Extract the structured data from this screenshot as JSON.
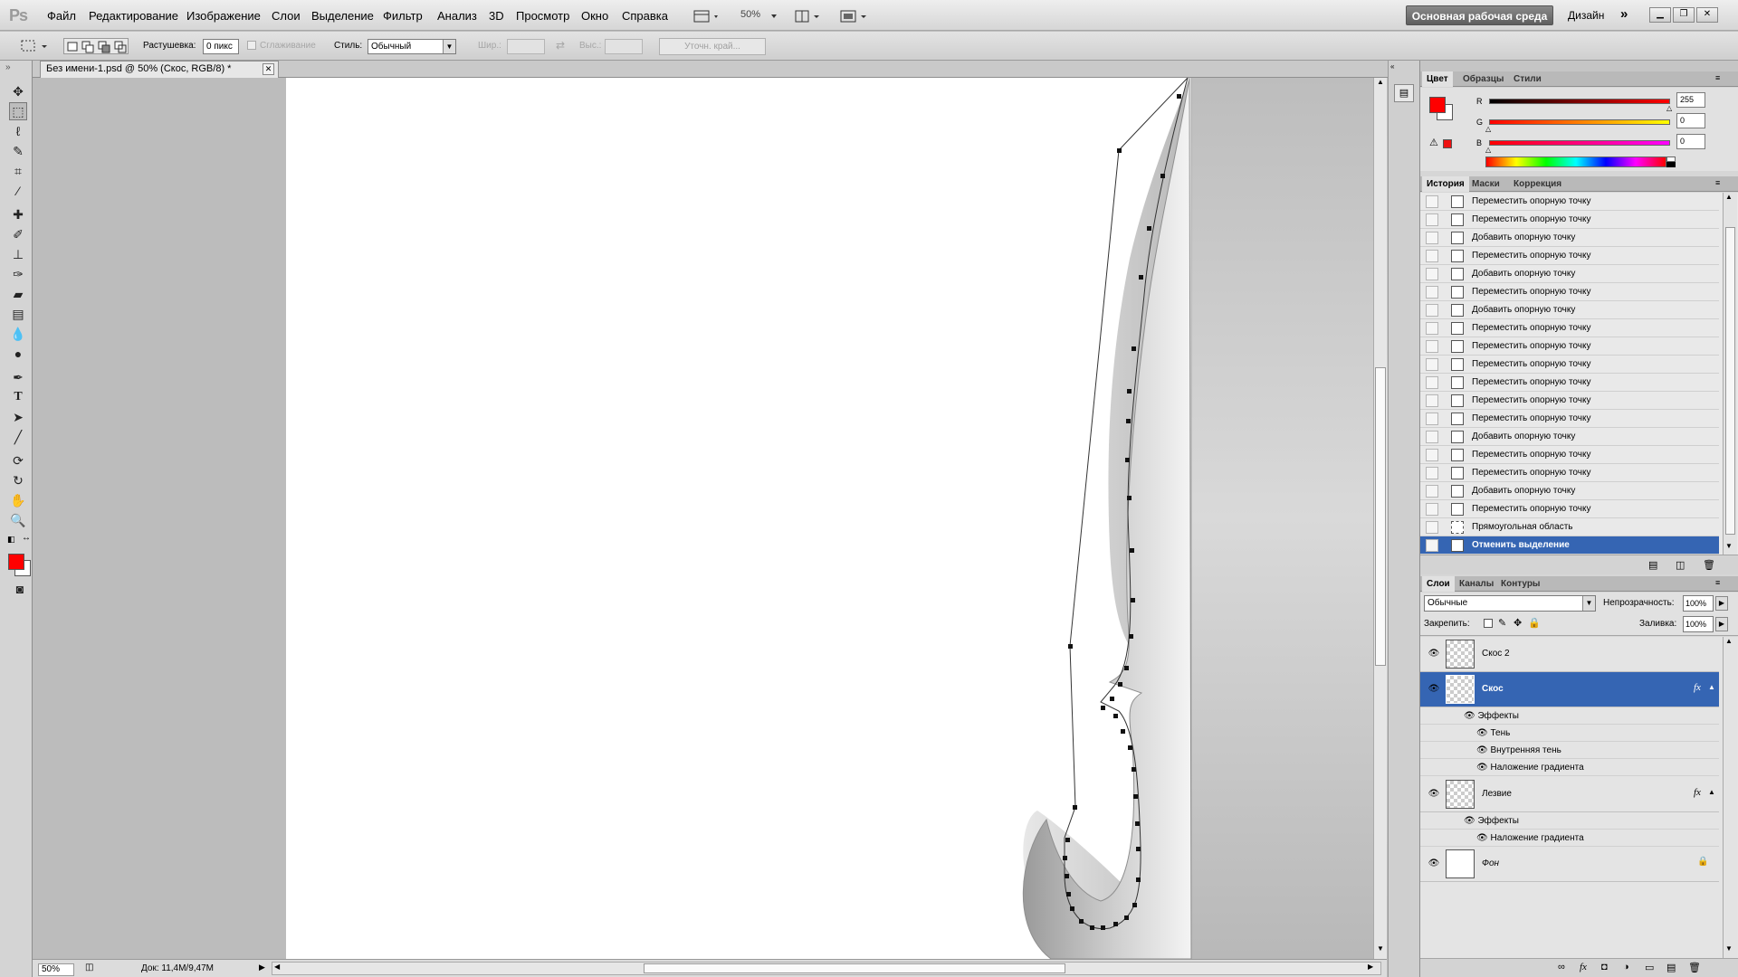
{
  "app": {
    "logo": "Ps"
  },
  "menu": [
    "Файл",
    "Редактирование",
    "Изображение",
    "Слои",
    "Выделение",
    "Фильтр",
    "Анализ",
    "3D",
    "Просмотр",
    "Окно",
    "Справка"
  ],
  "appbar": {
    "zoom": "50%",
    "workspace": "Основная рабочая среда",
    "design": "Дизайн"
  },
  "options": {
    "feather_label": "Растушевка:",
    "feather_value": "0 пикс",
    "antialias_label": "Сглаживание",
    "style_label": "Стиль:",
    "style_value": "Обычный",
    "width_label": "Шир.:",
    "height_label": "Выс.:",
    "refine_label": "Уточн. край..."
  },
  "document": {
    "tab_title": "Без имени-1.psd @ 50% (Скос, RGB/8) *"
  },
  "status": {
    "zoom": "50%",
    "doc_info": "Док: 11,4M/9,47M"
  },
  "colors": {
    "foreground": "#ff0000",
    "background": "#ffffff"
  },
  "color_panel": {
    "tabs": [
      "Цвет",
      "Образцы",
      "Стили"
    ],
    "channels": [
      {
        "label": "R",
        "value": "255"
      },
      {
        "label": "G",
        "value": "0"
      },
      {
        "label": "B",
        "value": "0"
      }
    ]
  },
  "history_panel": {
    "tabs": [
      "История",
      "Маски",
      "Коррекция"
    ],
    "items": [
      "Переместить опорную точку",
      "Переместить опорную точку",
      "Добавить опорную точку",
      "Переместить опорную точку",
      "Добавить опорную точку",
      "Переместить опорную точку",
      "Добавить опорную точку",
      "Переместить опорную точку",
      "Переместить опорную точку",
      "Переместить опорную точку",
      "Переместить опорную точку",
      "Переместить опорную точку",
      "Переместить опорную точку",
      "Добавить опорную точку",
      "Переместить опорную точку",
      "Переместить опорную точку",
      "Добавить опорную точку",
      "Переместить опорную точку",
      "Прямоугольная область",
      "Отменить выделение"
    ]
  },
  "layers_panel": {
    "tabs": [
      "Слои",
      "Каналы",
      "Контуры"
    ],
    "blend_mode": "Обычные",
    "opacity_label": "Непрозрачность:",
    "opacity_value": "100%",
    "lock_label": "Закрепить:",
    "fill_label": "Заливка:",
    "fill_value": "100%",
    "layers": [
      {
        "name": "Скос 2"
      },
      {
        "name": "Скос",
        "effects_label": "Эффекты",
        "effects": [
          "Тень",
          "Внутренняя тень",
          "Наложение градиента"
        ]
      },
      {
        "name": "Лезвие",
        "effects_label": "Эффекты",
        "effects": [
          "Наложение градиента"
        ]
      },
      {
        "name": "Фон"
      }
    ]
  }
}
